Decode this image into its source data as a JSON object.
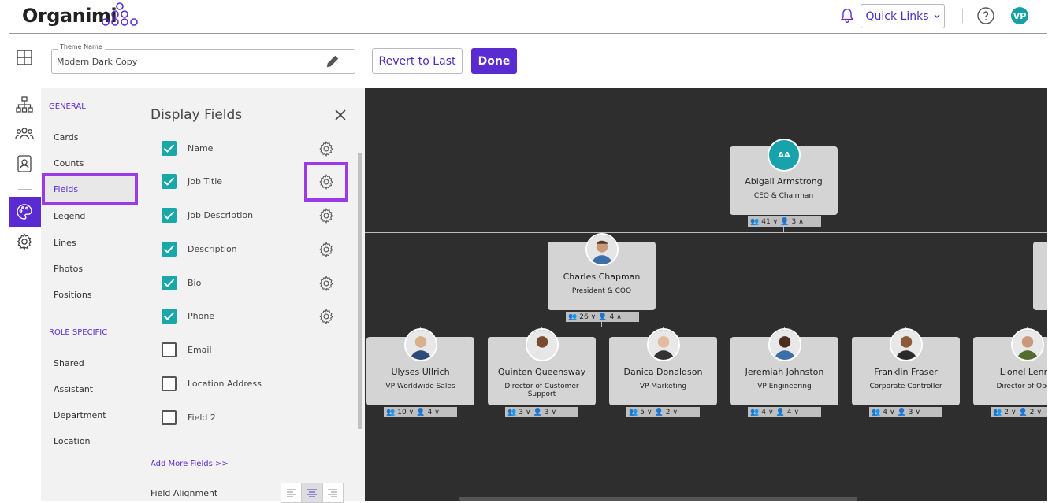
{
  "header": {
    "logo_text": "Organimi",
    "quick_links_label": "Quick Links",
    "avatar_initials": "VP",
    "colors": {
      "brand": "#5a2bd0",
      "accent": "#16a1a7"
    }
  },
  "theme_bar": {
    "theme_name_legend": "Theme Name",
    "theme_name_value": "Modern Dark Copy",
    "revert_label": "Revert to Last",
    "done_label": "Done"
  },
  "subnav": {
    "general_heading": "GENERAL",
    "general_items": [
      "Cards",
      "Counts",
      "Fields",
      "Legend",
      "Lines",
      "Photos",
      "Positions"
    ],
    "active_item": "Fields",
    "role_heading": "ROLE SPECIFIC",
    "role_items": [
      "Shared",
      "Assistant",
      "Department",
      "Location"
    ]
  },
  "panel": {
    "title": "Display Fields",
    "fields": [
      {
        "label": "Name",
        "checked": true
      },
      {
        "label": "Job Title",
        "checked": true
      },
      {
        "label": "Job Description",
        "checked": true
      },
      {
        "label": "Description",
        "checked": true
      },
      {
        "label": "Bio",
        "checked": true
      },
      {
        "label": "Phone",
        "checked": true
      },
      {
        "label": "Email",
        "checked": false
      },
      {
        "label": "Location Address",
        "checked": false
      },
      {
        "label": "Field 2",
        "checked": false
      }
    ],
    "add_more": "Add More Fields >>",
    "alignment_label": "Field Alignment",
    "alignment_selected": "center"
  },
  "chart": {
    "root": {
      "initials": "AA",
      "name": "Abigail Armstrong",
      "title": "CEO & Chairman",
      "team": "41",
      "direct": "3"
    },
    "level2": {
      "name": "Charles Chapman",
      "title": "President & COO",
      "team": "26",
      "direct": "4"
    },
    "level3": [
      {
        "name": "Ulyses Ullrich",
        "title": "VP Worldwide Sales",
        "team": "10",
        "direct": "4"
      },
      {
        "name": "Quinten Queensway",
        "title": "Director of Customer Support",
        "team": "3",
        "direct": "3"
      },
      {
        "name": "Danica Donaldson",
        "title": "VP Marketing",
        "team": "5",
        "direct": "2"
      },
      {
        "name": "Jeremiah Johnston",
        "title": "VP Engineering",
        "team": "4",
        "direct": "4"
      },
      {
        "name": "Franklin Fraser",
        "title": "Corporate Controller",
        "team": "4",
        "direct": "3"
      },
      {
        "name": "Lionel Lenno",
        "title": "Director of Opera",
        "team": "2",
        "direct": "2"
      }
    ]
  }
}
